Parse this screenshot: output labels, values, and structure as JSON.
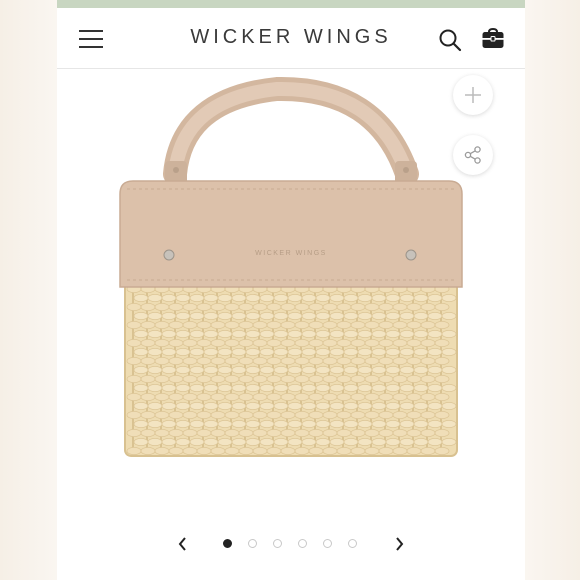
{
  "app": {
    "brand": "WICKER WINGS"
  },
  "header": {
    "menu_icon": "hamburger-menu-icon",
    "search_icon": "search-icon",
    "cart_icon": "bag-icon"
  },
  "actions": {
    "add_icon": "plus-icon",
    "share_icon": "share-icon"
  },
  "product": {
    "flap_imprint": "WICKER WINGS",
    "colors": {
      "leather": "#dcc1aa",
      "wicker": "#eedcb2",
      "accent_bar": "#c8d6c1"
    }
  },
  "carousel": {
    "slide_count": 6,
    "active_index": 0,
    "prev_icon": "chevron-left-icon",
    "next_icon": "chevron-right-icon"
  }
}
